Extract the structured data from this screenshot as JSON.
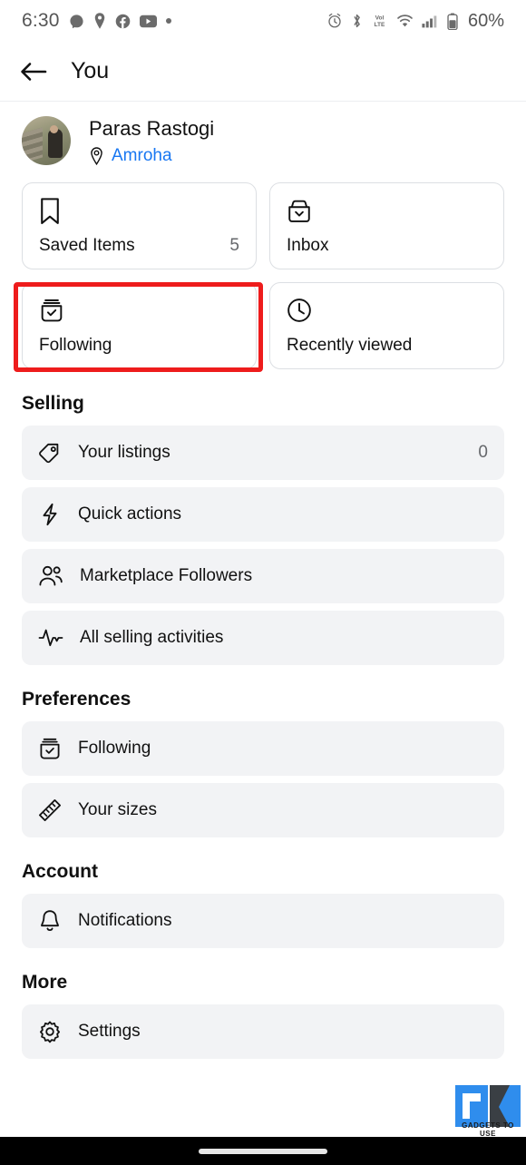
{
  "statusbar": {
    "time": "6:30",
    "left_icons": [
      "messenger-icon",
      "maps-pin-icon",
      "facebook-icon",
      "youtube-icon",
      "more-dot-icon"
    ],
    "right_icons": [
      "alarm-icon",
      "bluetooth-icon",
      "volte-icon",
      "wifi-icon",
      "cellular-signal-icon",
      "battery-icon"
    ],
    "battery_percent": "60%",
    "volte_top": "Vol",
    "volte_bottom": "LTE"
  },
  "appbar": {
    "back_label": "Back",
    "title": "You"
  },
  "profile": {
    "name": "Paras Rastogi",
    "location": "Amroha",
    "location_icon": "location-pin-icon",
    "location_color": "#1877f2",
    "avatar_alt": "Profile photo"
  },
  "quick_cards": [
    {
      "label": "Saved Items",
      "count": "5",
      "icon": "bookmark-icon",
      "highlighted": true
    },
    {
      "label": "Inbox",
      "count": "",
      "icon": "inbox-tray-icon",
      "highlighted": false
    },
    {
      "label": "Following",
      "count": "",
      "icon": "basket-check-icon",
      "highlighted": false
    },
    {
      "label": "Recently viewed",
      "count": "",
      "icon": "clock-icon",
      "highlighted": false
    }
  ],
  "sections": [
    {
      "title": "Selling",
      "rows": [
        {
          "label": "Your listings",
          "count": "0",
          "icon": "price-tag-icon"
        },
        {
          "label": "Quick actions",
          "count": "",
          "icon": "lightning-bolt-icon"
        },
        {
          "label": "Marketplace Followers",
          "count": "",
          "icon": "people-icon"
        },
        {
          "label": "All selling activities",
          "count": "",
          "icon": "activity-pulse-icon"
        }
      ]
    },
    {
      "title": "Preferences",
      "rows": [
        {
          "label": "Following",
          "count": "",
          "icon": "basket-check-icon"
        },
        {
          "label": "Your sizes",
          "count": "",
          "icon": "ruler-icon"
        }
      ]
    },
    {
      "title": "Account",
      "rows": [
        {
          "label": "Notifications",
          "count": "",
          "icon": "bell-icon"
        }
      ]
    },
    {
      "title": "More",
      "rows": [
        {
          "label": "Settings",
          "count": "",
          "icon": "gear-icon"
        }
      ]
    }
  ],
  "watermark": {
    "text": "GADGETS TO USE",
    "brand_color": "#2f8ded"
  },
  "colors": {
    "row_background": "#f2f3f5",
    "card_border": "#dcdfe3",
    "highlight_red": "#ee1c1c",
    "link_blue": "#1877f2",
    "nav_black": "#000000"
  }
}
